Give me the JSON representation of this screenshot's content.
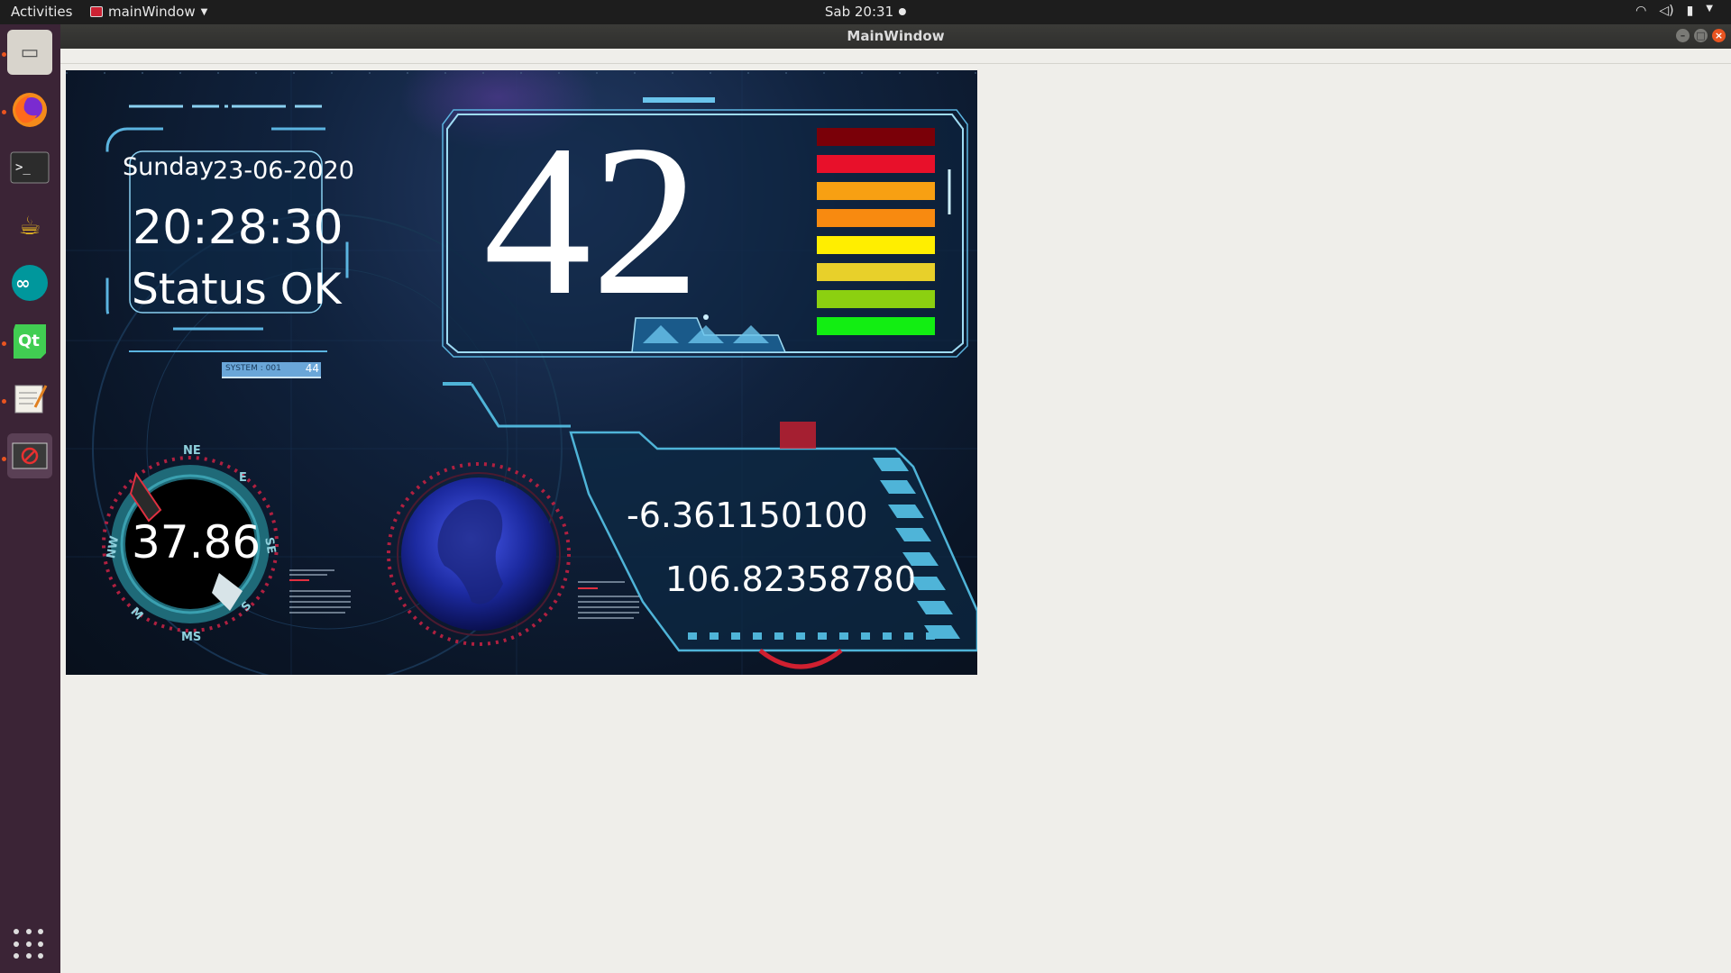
{
  "topbar": {
    "activities": "Activities",
    "app_menu": "mainWindow",
    "clock": "Sab 20:31"
  },
  "window": {
    "title": "MainWindow"
  },
  "dock": {
    "items": [
      "files-icon",
      "firefox-icon",
      "terminal-icon",
      "teapot-icon",
      "arduino-icon",
      "qt-creator-icon",
      "text-editor-icon",
      "stop-app-icon"
    ]
  },
  "dashboard": {
    "day": "Sunday",
    "date": "23-06-2020",
    "time": "20:28:30",
    "status": "Status OK",
    "big_value": "42",
    "system_label": "SYSTEM : 001",
    "system_value": "44",
    "speed_value": "37.86",
    "latitude": "-6.361150100",
    "longitude": "106.82358780",
    "compass": {
      "ne": "NE",
      "e": "E",
      "se": "SE",
      "s": "S",
      "ms": "MS",
      "m": "M",
      "nw": "NW"
    },
    "level_bars": {
      "colors": [
        "#7a0008",
        "#e8102a",
        "#f8a012",
        "#f88a10",
        "#ffee00",
        "#e8d02a",
        "#8cd010",
        "#12ee12"
      ]
    }
  }
}
